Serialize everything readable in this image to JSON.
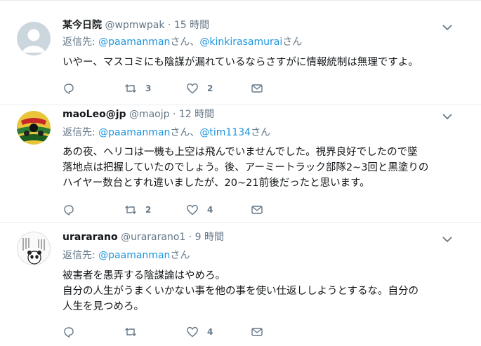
{
  "tweets": [
    {
      "name": "某今日院",
      "handle": "@wpmwpak",
      "sep": "·",
      "time": "15 時間",
      "reply_prefix": "返信先: ",
      "reply_user1": "@paamanman",
      "reply_mid": "さん、",
      "reply_user2": "@kinkirasamurai",
      "reply_suffix": "さん",
      "text_lines": [
        "いやー、マスコミにも陰謀が漏れているならさすがに情報統制は無理ですよ。"
      ],
      "retweets": "3",
      "likes": "2"
    },
    {
      "name": "maoLeo@jp",
      "handle": "@maojp",
      "sep": "·",
      "time": "12 時間",
      "reply_prefix": "返信先: ",
      "reply_user1": "@paamanman",
      "reply_mid": "さん、",
      "reply_user2": "@tim1134",
      "reply_suffix": "さん",
      "text_lines": [
        "あの夜、ヘリコは一機も上空は飛んでいませんでした。視界良好でしたので墜",
        "落地点は把握していたのでしょう。後、アーミートラック部隊2~3回と黒塗りの",
        "ハイヤー数台とすれ違いましたが、20~21前後だったと思います。"
      ],
      "retweets": "2",
      "likes": "4"
    },
    {
      "name": "urararano",
      "handle": "@urararano1",
      "sep": "·",
      "time": "9 時間",
      "reply_prefix": "返信先: ",
      "reply_user1": "@paamanman",
      "reply_mid": "さん",
      "reply_user2": "",
      "reply_suffix": "",
      "text_lines": [
        "被害者を愚弄する陰謀論はやめろ。",
        "自分の人生がうまくいかない事を他の事を使い仕返ししようとするな。自分の",
        "人生を見つめろ。"
      ],
      "retweets": "",
      "likes": "4"
    }
  ],
  "colors": {
    "link": "#1b95e0",
    "muted": "#657786",
    "border": "#e6ecf0"
  },
  "icons": [
    "chevron-down-icon",
    "reply-icon",
    "retweet-icon",
    "like-icon",
    "dm-icon"
  ]
}
